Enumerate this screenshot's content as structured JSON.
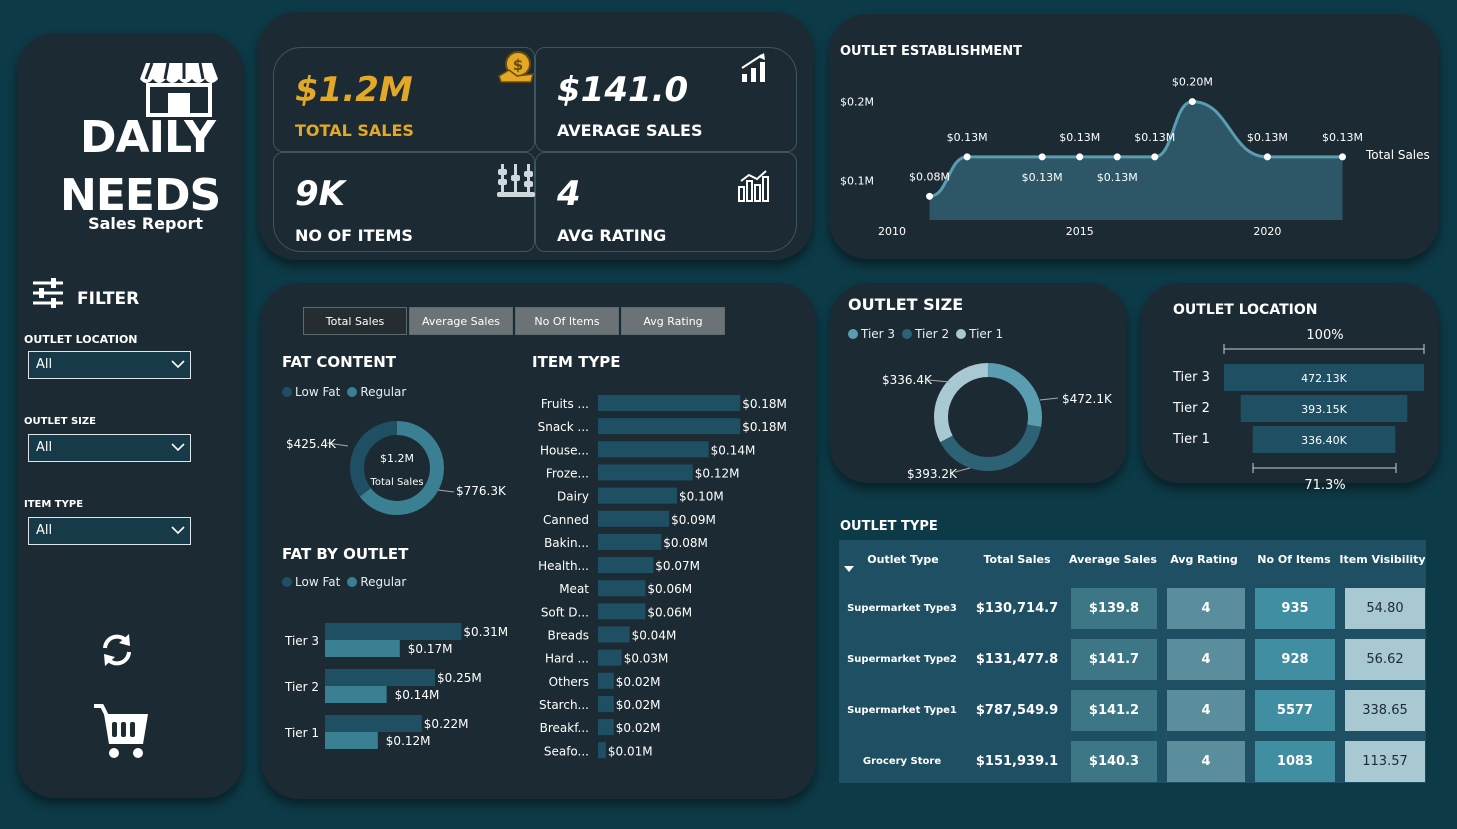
{
  "sidebar": {
    "title_line1": "DAILY",
    "title_line2": "NEEDS",
    "subtitle": "Sales Report",
    "filter_title": "FILTER",
    "filters": [
      {
        "label": "OUTLET LOCATION",
        "value": "All"
      },
      {
        "label": "OUTLET SIZE",
        "value": "All"
      },
      {
        "label": "ITEM TYPE",
        "value": "All"
      }
    ]
  },
  "kpis": {
    "total_sales": {
      "value": "$1.2M",
      "label": "TOTAL SALES"
    },
    "average_sales": {
      "value": "$141.0",
      "label": "AVERAGE SALES"
    },
    "no_of_items": {
      "value": "9K",
      "label": "NO OF ITEMS"
    },
    "avg_rating": {
      "value": "4",
      "label": "AVG RATING"
    }
  },
  "tabs": [
    "Total Sales",
    "Average Sales",
    "No Of Items",
    "Avg Rating"
  ],
  "colors": {
    "accent_gold": "#e3a826",
    "teal_dark": "#1f4f63",
    "teal_mid": "#3b7f92",
    "teal_light": "#5a9db0",
    "pale": "#a8c8d2",
    "panel": "#1c2b33",
    "background": "#0d3a47"
  },
  "fat_content": {
    "title": "FAT CONTENT",
    "legend": [
      "Low Fat",
      "Regular"
    ],
    "center_value": "$1.2M",
    "center_label": "Total Sales",
    "low_fat_label": "$425.4K",
    "regular_label": "$776.3K"
  },
  "fat_by_outlet": {
    "title": "FAT BY OUTLET",
    "legend": [
      "Low Fat",
      "Regular"
    ]
  },
  "item_type": {
    "title": "ITEM TYPE"
  },
  "outlet_establishment": {
    "title": "OUTLET ESTABLISHMENT",
    "series_label": "Total Sales"
  },
  "outlet_size": {
    "title": "OUTLET SIZE",
    "legend": [
      "Tier 3",
      "Tier 2",
      "Tier 1"
    ],
    "labels": [
      "$336.4K",
      "$472.1K",
      "$393.2K"
    ]
  },
  "outlet_location": {
    "title": "OUTLET LOCATION",
    "top_pct": "100%",
    "bottom_pct": "71.3%"
  },
  "outlet_type": {
    "title": "OUTLET TYPE",
    "headers": [
      "Outlet Type",
      "Total Sales",
      "Average Sales",
      "Avg Rating",
      "No Of Items",
      "Item Visibility"
    ],
    "rows": [
      [
        "Supermarket Type3",
        "$130,714.7",
        "$139.8",
        "4",
        "935",
        "54.80"
      ],
      [
        "Supermarket Type2",
        "$131,477.8",
        "$141.7",
        "4",
        "928",
        "56.62"
      ],
      [
        "Supermarket Type1",
        "$787,549.9",
        "$141.2",
        "4",
        "5577",
        "338.65"
      ],
      [
        "Grocery Store",
        "$151,939.1",
        "$140.3",
        "4",
        "1083",
        "113.57"
      ]
    ]
  },
  "chart_data": [
    {
      "type": "pie",
      "title": "FAT CONTENT",
      "categories": [
        "Low Fat",
        "Regular"
      ],
      "values": [
        425.4,
        776.3
      ],
      "value_labels": [
        "$425.4K",
        "$776.3K"
      ]
    },
    {
      "type": "bar",
      "title": "FAT BY OUTLET",
      "categories": [
        "Tier 3",
        "Tier 2",
        "Tier 1"
      ],
      "series": [
        {
          "name": "Low Fat",
          "values": [
            0.31,
            0.25,
            0.22
          ],
          "labels": [
            "$0.31M",
            "$0.25M",
            "$0.22M"
          ]
        },
        {
          "name": "Regular",
          "values": [
            0.17,
            0.14,
            0.12
          ],
          "labels": [
            "$0.17M",
            "$0.14M",
            "$0.12M"
          ]
        }
      ]
    },
    {
      "type": "bar",
      "title": "ITEM TYPE",
      "categories": [
        "Fruits ...",
        "Snack ...",
        "House...",
        "Froze...",
        "Dairy",
        "Canned",
        "Bakin...",
        "Health...",
        "Meat",
        "Soft D...",
        "Breads",
        "Hard ...",
        "Others",
        "Starch...",
        "Breakf...",
        "Seafo..."
      ],
      "values": [
        0.18,
        0.18,
        0.14,
        0.12,
        0.1,
        0.09,
        0.08,
        0.07,
        0.06,
        0.06,
        0.04,
        0.03,
        0.02,
        0.02,
        0.02,
        0.01
      ],
      "labels": [
        "$0.18M",
        "$0.18M",
        "$0.14M",
        "$0.12M",
        "$0.10M",
        "$0.09M",
        "$0.08M",
        "$0.07M",
        "$0.06M",
        "$0.06M",
        "$0.04M",
        "$0.03M",
        "$0.02M",
        "$0.02M",
        "$0.02M",
        "$0.01M"
      ]
    },
    {
      "type": "area",
      "title": "OUTLET ESTABLISHMENT",
      "x": [
        2011,
        2012,
        2014,
        2015,
        2016,
        2017,
        2018,
        2020,
        2022
      ],
      "values": [
        0.08,
        0.13,
        0.13,
        0.13,
        0.13,
        0.13,
        0.2,
        0.13,
        0.13
      ],
      "labels": [
        "$0.08M",
        "$0.13M",
        "$0.13M",
        "$0.13M",
        "$0.13M",
        "$0.13M",
        "$0.20M",
        "$0.13M",
        "$0.13M"
      ],
      "x_ticks": [
        "2010",
        "2015",
        "2020"
      ],
      "y_ticks": [
        "$0.1M",
        "$0.2M"
      ]
    },
    {
      "type": "pie",
      "title": "OUTLET SIZE",
      "categories": [
        "Tier 3",
        "Tier 2",
        "Tier 1"
      ],
      "values": [
        336.4,
        472.1,
        393.2
      ],
      "value_labels": [
        "$336.4K",
        "$472.1K",
        "$393.2K"
      ]
    },
    {
      "type": "bar",
      "title": "OUTLET LOCATION",
      "categories": [
        "Tier 3",
        "Tier 2",
        "Tier 1"
      ],
      "values": [
        472.13,
        393.15,
        336.4
      ],
      "labels": [
        "472.13K",
        "393.15K",
        "336.40K"
      ]
    }
  ]
}
